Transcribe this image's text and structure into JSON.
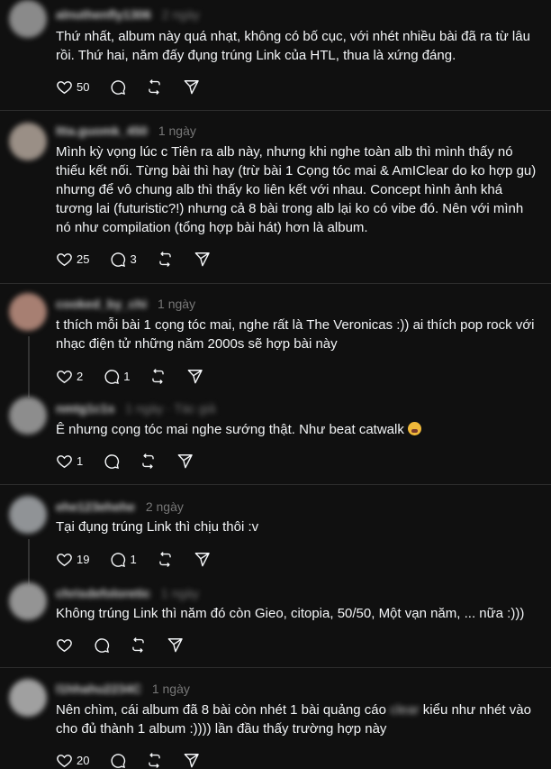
{
  "posts": [
    {
      "username": "alnuthenfly1306",
      "time": "2 ngày",
      "text": "Thứ nhất, album này quá nhạt, không có bố cục, với nhét nhiều bài đã ra từ lâu rồi. Thứ hai, năm đấy đụng trúng Link của HTL, thua là xứng đáng.",
      "likes": "50",
      "replies": ""
    },
    {
      "username": "ltta.guomk_450",
      "time": "1 ngày",
      "text": "Mình kỳ vọng lúc c Tiên ra alb này, nhưng khi nghe toàn alb thì mình thấy nó thiếu kết nối. Từng bài thì hay (trừ bài 1 Cọng tóc mai & AmIClear do ko hợp gu) nhưng để vô chung alb thì thấy ko liên kết với nhau. Concept hình ảnh khá tương lai (futuristic?!) nhưng cả 8 bài trong alb lại ko có vibe đó. Nên với mình nó như compilation (tổng hợp bài hát) hơn là album.",
      "likes": "25",
      "replies": "3"
    },
    {
      "username": "cooked_by_chi",
      "time": "1 ngày",
      "text": "t thích mỗi bài 1 cọng tóc mai, nghe rất là The Veronicas :)) ai thích pop rock với nhạc điện tử những năm 2000s sẽ hợp bài này",
      "likes": "2",
      "replies": "1"
    },
    {
      "username": "nmtg1c1s",
      "time": "1 ngày · Tác giả",
      "text": "Ê nhưng cọng tóc mai nghe sướng thật. Như beat catwalk",
      "likes": "1",
      "replies": ""
    },
    {
      "username": "ehe123ehehe",
      "time": "2 ngày",
      "text": "Tại đụng trúng Link thì chịu thôi :v",
      "likes": "19",
      "replies": "1"
    },
    {
      "username": "chrisdefoloretic",
      "time": "1 ngày",
      "text": "Không trúng Link thì năm đó còn Gieo, citopia, 50/50, Một vạn năm, ... nữa :)))",
      "likes": "",
      "replies": ""
    },
    {
      "username": "l1hhahu2234C",
      "time": "1 ngày",
      "text_before": "Nên chìm, cái album đã 8 bài còn nhét 1 bài quảng cáo",
      "text_blur": " clear ",
      "text_after": "kiểu như nhét vào cho đủ thành 1 album :)))) lần đầu thấy trường hợp này",
      "likes": "20",
      "replies": ""
    }
  ]
}
